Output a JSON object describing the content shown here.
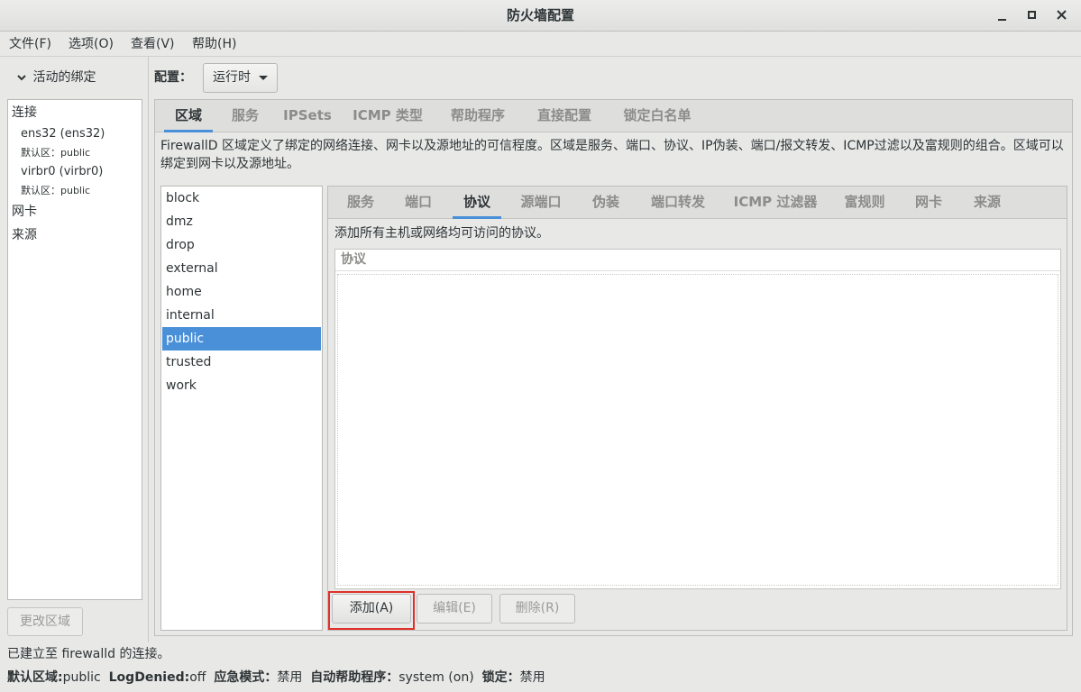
{
  "window": {
    "title": "防火墙配置",
    "minimize_icon": "minimize-icon",
    "maximize_icon": "maximize-icon",
    "close_icon": "close-icon"
  },
  "menubar": [
    "文件(F)",
    "选项(O)",
    "查看(V)",
    "帮助(H)"
  ],
  "bindings": {
    "header": "活动的绑定",
    "connections_label": "连接",
    "connections": [
      {
        "name": "ens32 (ens32)",
        "zone_label": "默认区：",
        "zone": "public"
      },
      {
        "name": "virbr0 (virbr0)",
        "zone_label": "默认区：",
        "zone": "public"
      }
    ],
    "nic_label": "网卡",
    "source_label": "来源",
    "change_zone_button": "更改区域"
  },
  "config": {
    "label": "配置：",
    "value": "运行时"
  },
  "main_tabs": [
    "区域",
    "服务",
    "IPSets",
    "ICMP 类型",
    "帮助程序",
    "直接配置",
    "锁定白名单"
  ],
  "main_active_tab": "区域",
  "zone_description": "FirewallD 区域定义了绑定的网络连接、网卡以及源地址的可信程度。区域是服务、端口、协议、IP伪装、端口/报文转发、ICMP过滤以及富规则的组合。区域可以绑定到网卡以及源地址。",
  "zones": [
    "block",
    "dmz",
    "drop",
    "external",
    "home",
    "internal",
    "public",
    "trusted",
    "work"
  ],
  "selected_zone": "public",
  "sub_tabs": [
    "服务",
    "端口",
    "协议",
    "源端口",
    "伪装",
    "端口转发",
    "ICMP 过滤器",
    "富规则",
    "网卡",
    "来源"
  ],
  "sub_active_tab": "协议",
  "protocols": {
    "description": "添加所有主机或网络均可访问的协议。",
    "column_header": "协议",
    "add_button": "添加(A)",
    "edit_button": "编辑(E)",
    "delete_button": "删除(R)"
  },
  "status": {
    "connection": "已建立至  firewalld 的连接。",
    "default_zone_label": "默认区域:",
    "default_zone": "public",
    "log_denied_label": "LogDenied:",
    "log_denied": "off",
    "panic_label": "应急模式：",
    "panic": "禁用",
    "auto_helpers_label": "自动帮助程序：",
    "auto_helpers": "system (on)",
    "lockdown_label": "锁定：",
    "lockdown": "禁用"
  },
  "colors": {
    "accent": "#4a90d9",
    "highlight_box": "#e0302a"
  }
}
